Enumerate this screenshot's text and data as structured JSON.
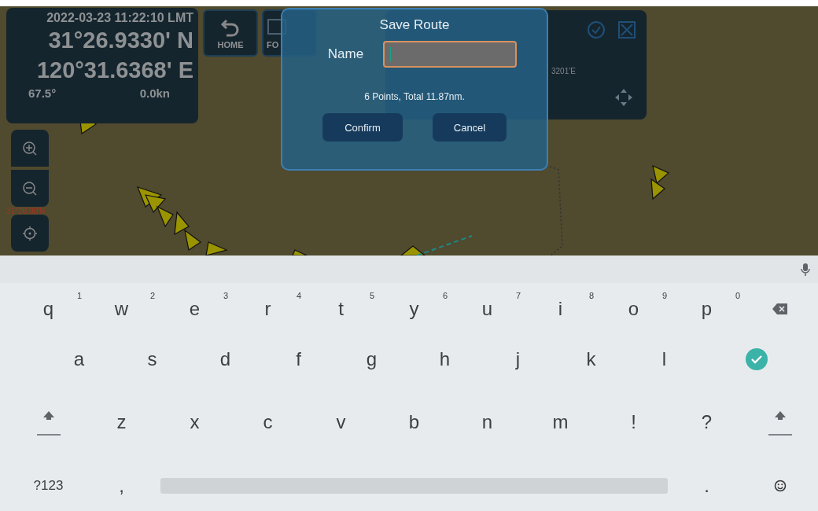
{
  "status": {
    "clock": "2022-03-23 11:22:10 LMT",
    "latitude": "31°26.9330' N",
    "longitude": "120°31.6368' E",
    "heading": "67.5°",
    "speed": "0.0kn"
  },
  "toolbar": [
    {
      "kind": "home",
      "label": "HOME"
    },
    {
      "kind": "follow",
      "label": "FO"
    }
  ],
  "map": {
    "grid_label": "31°28.00'N"
  },
  "route_panel": {
    "coordinate": "3201'E"
  },
  "dialog": {
    "title": "Save Route",
    "field_label": "Name",
    "summary": "6 Points, Total 11.87nm.",
    "buttons": [
      "Confirm",
      "Cancel"
    ]
  },
  "keyboard": {
    "rows": [
      [
        {
          "kind": "char",
          "label": "q",
          "hint": "1"
        },
        {
          "kind": "char",
          "label": "w",
          "hint": "2"
        },
        {
          "kind": "char",
          "label": "e",
          "hint": "3"
        },
        {
          "kind": "char",
          "label": "r",
          "hint": "4"
        },
        {
          "kind": "char",
          "label": "t",
          "hint": "5"
        },
        {
          "kind": "char",
          "label": "y",
          "hint": "6"
        },
        {
          "kind": "char",
          "label": "u",
          "hint": "7"
        },
        {
          "kind": "char",
          "label": "i",
          "hint": "8"
        },
        {
          "kind": "char",
          "label": "o",
          "hint": "9"
        },
        {
          "kind": "char",
          "label": "p",
          "hint": "0"
        },
        {
          "kind": "backspace"
        }
      ],
      [
        {
          "kind": "char",
          "label": "a"
        },
        {
          "kind": "char",
          "label": "s"
        },
        {
          "kind": "char",
          "label": "d"
        },
        {
          "kind": "char",
          "label": "f"
        },
        {
          "kind": "char",
          "label": "g"
        },
        {
          "kind": "char",
          "label": "h"
        },
        {
          "kind": "char",
          "label": "j"
        },
        {
          "kind": "char",
          "label": "k"
        },
        {
          "kind": "char",
          "label": "l"
        },
        {
          "kind": "enter"
        }
      ],
      [
        {
          "kind": "shift"
        },
        {
          "kind": "char",
          "label": "z"
        },
        {
          "kind": "char",
          "label": "x"
        },
        {
          "kind": "char",
          "label": "c"
        },
        {
          "kind": "char",
          "label": "v"
        },
        {
          "kind": "char",
          "label": "b"
        },
        {
          "kind": "char",
          "label": "n"
        },
        {
          "kind": "char",
          "label": "m"
        },
        {
          "kind": "char",
          "label": "!"
        },
        {
          "kind": "char",
          "label": "?"
        },
        {
          "kind": "shift"
        }
      ]
    ],
    "bottom_row": [
      {
        "kind": "symbols",
        "label": "?123"
      },
      {
        "kind": "char",
        "label": ","
      },
      {
        "kind": "space"
      },
      {
        "kind": "char",
        "label": "."
      },
      {
        "kind": "emoji"
      }
    ]
  }
}
